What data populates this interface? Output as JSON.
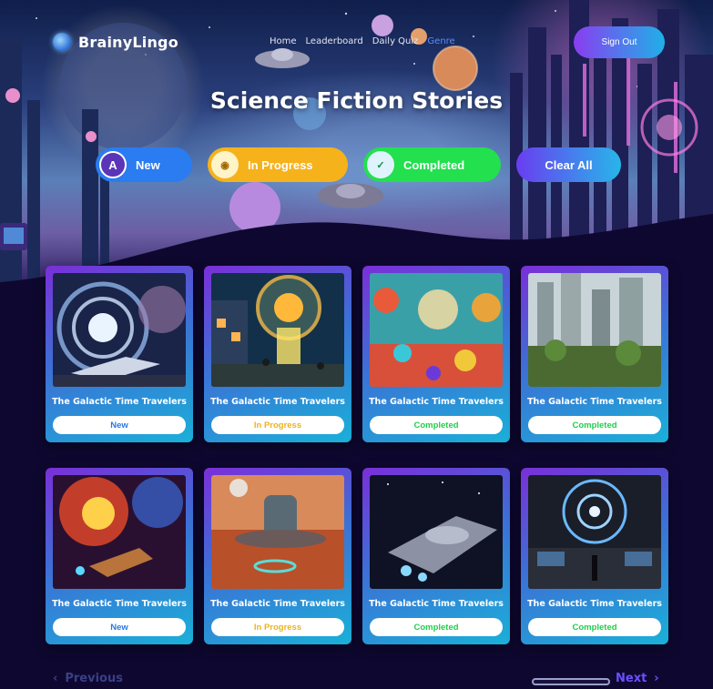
{
  "app": {
    "name": "BrainyLingo"
  },
  "nav": {
    "items": [
      "Home",
      "Leaderboard",
      "Daily Quiz",
      "Genre"
    ],
    "active_index": 3
  },
  "header": {
    "signout_label": "Sign Out"
  },
  "hero": {
    "title": "Science Fiction Stories"
  },
  "filters": {
    "new": {
      "label": "New",
      "icon": "A"
    },
    "in_progress": {
      "label": "In Progress"
    },
    "completed": {
      "label": "Completed"
    },
    "clear": {
      "label": "Clear All"
    }
  },
  "cards": [
    {
      "title": "The Galactic Time Travelers",
      "status": "New",
      "scene": "wormhole"
    },
    {
      "title": "The Galactic Time Travelers",
      "status": "In Progress",
      "scene": "portal-village"
    },
    {
      "title": "The Galactic Time Travelers",
      "status": "Completed",
      "scene": "alien-garden"
    },
    {
      "title": "The Galactic Time Travelers",
      "status": "Completed",
      "scene": "jungle-city"
    },
    {
      "title": "The Galactic Time Travelers",
      "status": "New",
      "scene": "nebula-battle"
    },
    {
      "title": "The Galactic Time Travelers",
      "status": "In Progress",
      "scene": "mars-base"
    },
    {
      "title": "The Galactic Time Travelers",
      "status": "Completed",
      "scene": "starship"
    },
    {
      "title": "The Galactic Time Travelers",
      "status": "Completed",
      "scene": "control-room"
    }
  ],
  "pagination": {
    "previous_label": "Previous",
    "next_label": "Next"
  },
  "colors": {
    "new": "#2a78e0",
    "in_progress": "#f0b21a",
    "completed": "#20cf4a",
    "accent": "#6b4fff"
  }
}
